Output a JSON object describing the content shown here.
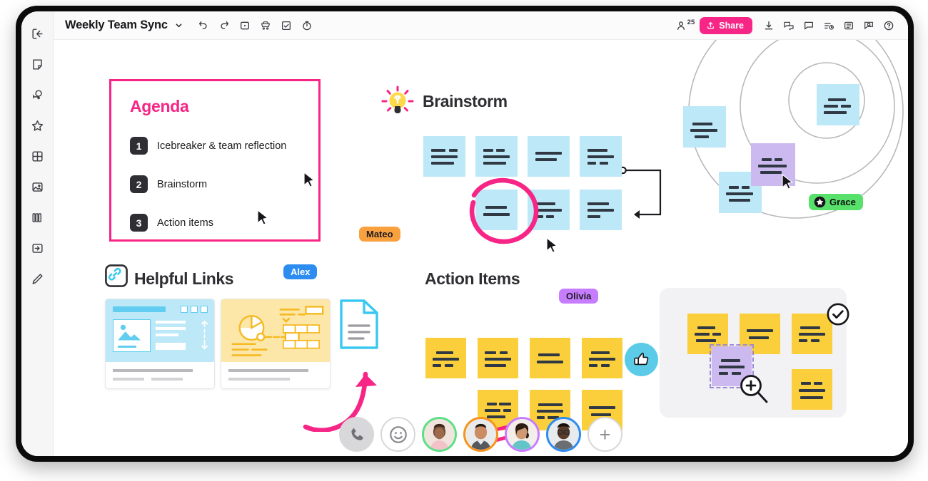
{
  "window": {
    "frame_color": "#0b0b0c"
  },
  "sidebar": {
    "items": [
      {
        "name": "exit-icon",
        "label": "Exit board"
      },
      {
        "name": "sticky-note-icon",
        "label": "Sticky note"
      },
      {
        "name": "stamp-icon",
        "label": "Stamp"
      },
      {
        "name": "star-icon",
        "label": "Favorites"
      },
      {
        "name": "grid-icon",
        "label": "Grid / table"
      },
      {
        "name": "image-icon",
        "label": "Image"
      },
      {
        "name": "library-icon",
        "label": "Library"
      },
      {
        "name": "import-icon",
        "label": "Import"
      },
      {
        "name": "pen-icon",
        "label": "Pen"
      }
    ]
  },
  "topbar": {
    "board_title": "Weekly Team Sync",
    "chevron": "chevron-down-icon",
    "left_tools": [
      {
        "name": "undo-icon",
        "label": "Undo"
      },
      {
        "name": "redo-icon",
        "label": "Redo"
      },
      {
        "name": "present-icon",
        "label": "Present"
      },
      {
        "name": "cart-icon",
        "label": "Templates"
      },
      {
        "name": "checkbox-icon",
        "label": "Tasks"
      },
      {
        "name": "timer-icon",
        "label": "Timer"
      }
    ],
    "people_count": "25",
    "share_label": "Share",
    "share_color": "#f72585",
    "right_tools": [
      {
        "name": "download-icon",
        "label": "Download"
      },
      {
        "name": "chats-icon",
        "label": "Chats"
      },
      {
        "name": "comment-icon",
        "label": "Comment"
      },
      {
        "name": "activity-icon",
        "label": "Activity"
      },
      {
        "name": "list-icon",
        "label": "List"
      },
      {
        "name": "search-doc-icon",
        "label": "Find"
      },
      {
        "name": "help-icon",
        "label": "Help"
      }
    ]
  },
  "agenda": {
    "title": "Agenda",
    "border_color": "#f72585",
    "items": [
      {
        "number": "1",
        "text": "Icebreaker & team reflection"
      },
      {
        "number": "2",
        "text": "Brainstorm"
      },
      {
        "number": "3",
        "text": "Action items"
      }
    ]
  },
  "sections": {
    "brainstorm": {
      "title": "Brainstorm",
      "icon": "lightbulb-icon"
    },
    "helpful_links": {
      "title": "Helpful Links",
      "icon": "link-icon"
    },
    "action_items": {
      "title": "Action Items"
    }
  },
  "collaborators": [
    {
      "name": "Mateo",
      "bg": "#f9a03f",
      "fg": "#1c1c20",
      "badge": null
    },
    {
      "name": "Alex",
      "bg": "#2d8cf0",
      "fg": "#ffffff",
      "badge": null
    },
    {
      "name": "Olivia",
      "bg": "#c77dff",
      "fg": "#1c1c20",
      "badge": null
    },
    {
      "name": "Grace",
      "bg": "#57e06a",
      "fg": "#0e0e10",
      "badge": "star-icon"
    }
  ],
  "notes": {
    "brainstorm_color": "#bce8f7",
    "action_color": "#fbcf3b",
    "purple_color": "#ccb9f0"
  },
  "reactions": {
    "thumbs_up": {
      "icon": "thumbs-up-icon",
      "bg": "#5bcbe8"
    },
    "check": {
      "icon": "check-circle-icon"
    },
    "zoom_in": {
      "icon": "zoom-in-icon"
    }
  },
  "bottombar": {
    "call_label": "Call",
    "emoji_label": "Reactions",
    "add_label": "+",
    "avatars": [
      {
        "name": "participant-1",
        "ring": "#5ddf86"
      },
      {
        "name": "participant-2",
        "ring": "#f7941d"
      },
      {
        "name": "participant-3",
        "ring": "#c77dff"
      },
      {
        "name": "participant-4",
        "ring": "#2d8cf0"
      }
    ]
  }
}
